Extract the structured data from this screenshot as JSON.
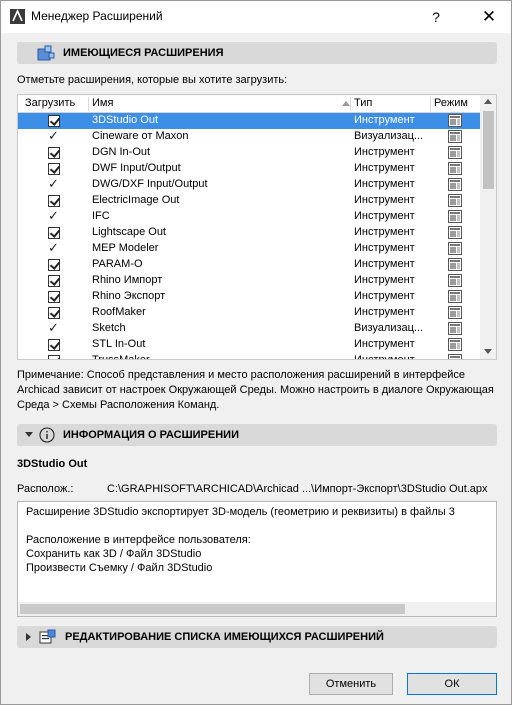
{
  "window": {
    "title": "Менеджер Расширений",
    "help_label": "?",
    "close_label": "✕"
  },
  "available": {
    "header": "ИМЕЮЩИЕСЯ РАСШИРЕНИЯ",
    "instruction": "Отметьте расширения, которые вы хотите загрузить:",
    "columns": {
      "load": "Загрузить",
      "name": "Имя",
      "type": "Тип",
      "mode": "Режим"
    },
    "rows": [
      {
        "checked": "box",
        "name": "3DStudio Out",
        "type": "Инструмент",
        "selected": true
      },
      {
        "checked": "tick",
        "name": "Cineware от Maxon",
        "type": "Визуализац..."
      },
      {
        "checked": "box",
        "name": "DGN In-Out",
        "type": "Инструмент"
      },
      {
        "checked": "box",
        "name": "DWF Input/Output",
        "type": "Инструмент"
      },
      {
        "checked": "tick",
        "name": "DWG/DXF Input/Output",
        "type": "Инструмент"
      },
      {
        "checked": "box",
        "name": "ElectricImage Out",
        "type": "Инструмент"
      },
      {
        "checked": "tick",
        "name": "IFC",
        "type": "Инструмент"
      },
      {
        "checked": "box",
        "name": "Lightscape Out",
        "type": "Инструмент"
      },
      {
        "checked": "tick",
        "name": "MEP Modeler",
        "type": "Инструмент"
      },
      {
        "checked": "box",
        "name": "PARAM-O",
        "type": "Инструмент"
      },
      {
        "checked": "box",
        "name": "Rhino Импорт",
        "type": "Инструмент"
      },
      {
        "checked": "box",
        "name": "Rhino Экспорт",
        "type": "Инструмент"
      },
      {
        "checked": "box",
        "name": "RoofMaker",
        "type": "Инструмент"
      },
      {
        "checked": "tick",
        "name": "Sketch",
        "type": "Визуализац..."
      },
      {
        "checked": "box",
        "name": "STL In-Out",
        "type": "Инструмент"
      },
      {
        "checked": "box",
        "name": "TrussMaker",
        "type": "Инструмент"
      }
    ],
    "note": "Примечание: Способ представления и место расположения расширений в интерфейсе Archicad зависит от настроек Окружающей Среды. Можно настроить в диалоге Окружающая Среда > Схемы Расположения Команд."
  },
  "info": {
    "header": "ИНФОРМАЦИЯ О РАСШИРЕНИИ",
    "ext_name": "3DStudio Out",
    "location_label": "Располож.:",
    "location_value": "C:\\GRAPHISOFT\\ARCHICAD\\Archicad ...\\Импорт-Экспорт\\3DStudio Out.apx",
    "description_lines": [
      "Расширение 3DStudio экспортирует 3D-модель (геометрию и реквизиты) в файлы 3",
      "",
      "Расположение в интерфейсе пользователя:",
      "Сохранить как 3D / Файл 3DStudio",
      "Произвести Съемку / Файл 3DStudio"
    ]
  },
  "edit_section": {
    "header": "РЕДАКТИРОВАНИЕ СПИСКА ИМЕЮЩИХСЯ РАСШИРЕНИЙ"
  },
  "buttons": {
    "cancel": "Отменить",
    "ok": "ОК"
  }
}
